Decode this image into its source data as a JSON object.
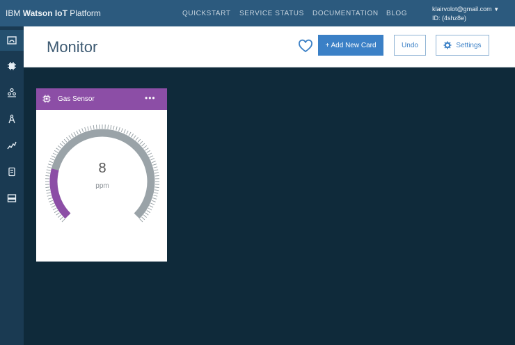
{
  "topbar": {
    "brand_prefix": "IBM",
    "brand_bold": "Watson IoT",
    "brand_suffix": "Platform",
    "nav": [
      "QUICKSTART",
      "SERVICE STATUS",
      "DOCUMENTATION",
      "BLOG"
    ],
    "user_email": "klairvolot@gmail.com",
    "user_caret": "▼",
    "user_id": "ID: (4shz8e)"
  },
  "sidebar": {
    "items": [
      {
        "icon": "dashboard-icon",
        "active": true
      },
      {
        "icon": "devices-icon",
        "active": false
      },
      {
        "icon": "members-icon",
        "active": false
      },
      {
        "icon": "apps-icon",
        "active": false
      },
      {
        "icon": "rules-icon",
        "active": false
      },
      {
        "icon": "usage-icon",
        "active": false
      },
      {
        "icon": "settings-panel-icon",
        "active": false
      }
    ]
  },
  "header": {
    "title": "Monitor",
    "add_card_label": "+ Add New Card",
    "undo_label": "Undo",
    "settings_label": "Settings"
  },
  "card": {
    "title": "Gas Sensor",
    "menu": "•••",
    "value": "8",
    "unit": "ppm",
    "gauge_fraction": 0.22,
    "accent": "#8c4ea6"
  },
  "colors": {
    "topbar": "#2c5a7e",
    "rail": "#1a3a52",
    "canvas": "#0f2a3a",
    "primary": "#3b80c6",
    "gauge_track": "#9aa3a8"
  }
}
